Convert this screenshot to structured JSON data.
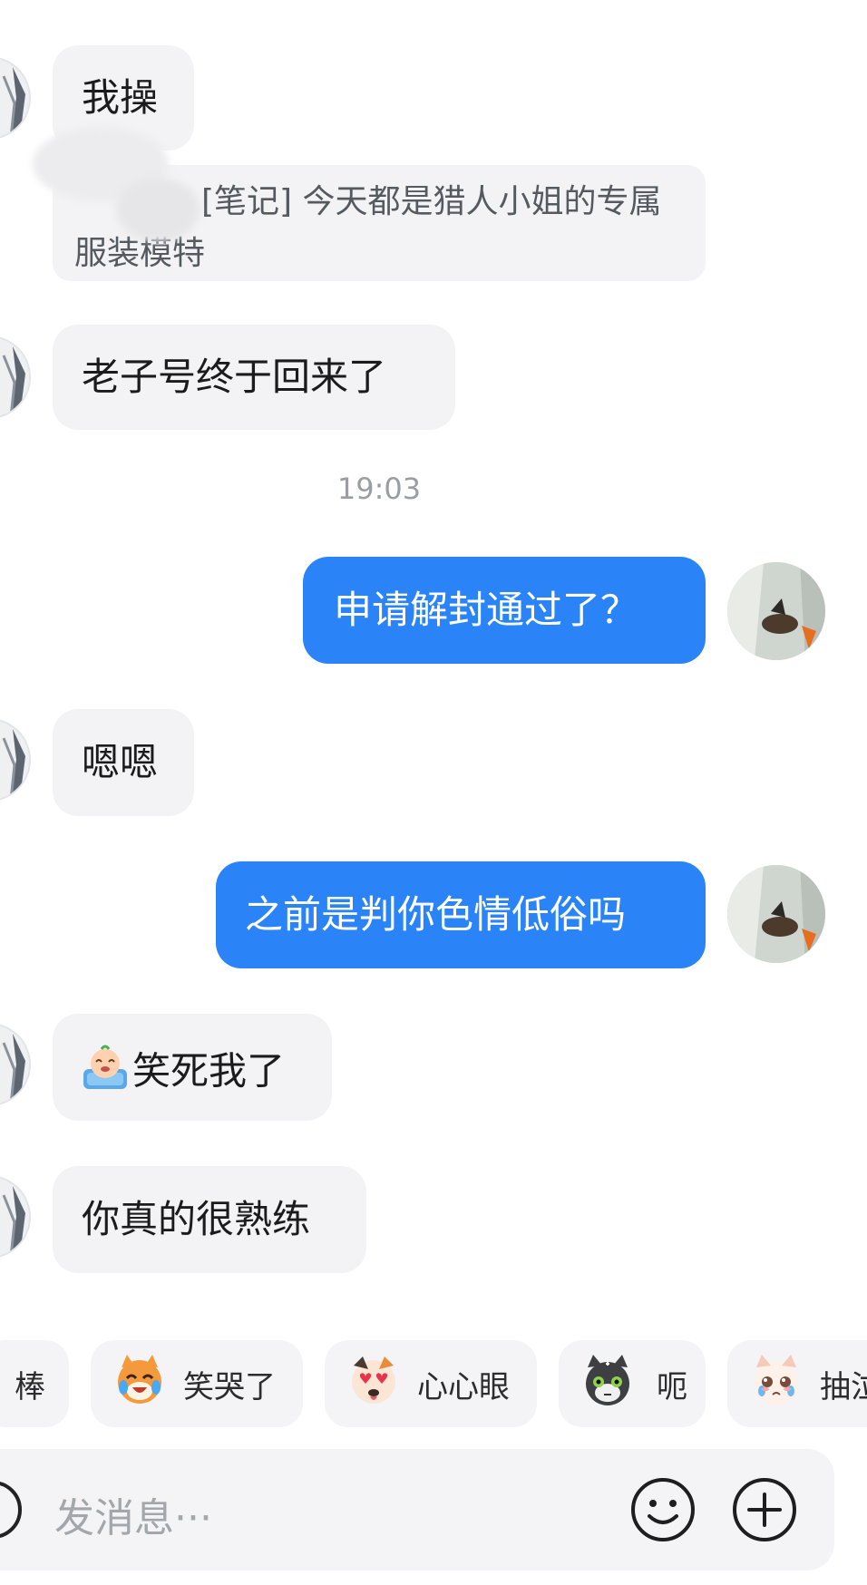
{
  "messages": [
    {
      "side": "left",
      "text": "我操"
    },
    {
      "side": "left",
      "type": "note_quote",
      "text": "[笔记] 今天都是猎人小姐的专属服装模特"
    },
    {
      "side": "left",
      "text": "老子号终于回来了"
    },
    {
      "side": "right",
      "text": "申请解封通过了？"
    },
    {
      "side": "left",
      "text": "嗯嗯"
    },
    {
      "side": "right",
      "text": "之前是判你色情低俗吗"
    },
    {
      "side": "left",
      "text": "笑死我了"
    },
    {
      "side": "left",
      "text": "你真的很熟练"
    }
  ],
  "timestamp": "19:03",
  "quick_reactions": [
    {
      "label": "棒"
    },
    {
      "label": "笑哭了",
      "icon": "crying-laughing-cat-icon"
    },
    {
      "label": "心心眼",
      "icon": "heart-eyes-dog-icon"
    },
    {
      "label": "呃",
      "icon": "awkward-cat-icon"
    },
    {
      "label": "抽泣",
      "icon": "sobbing-cat-icon"
    }
  ],
  "input": {
    "placeholder": "发消息···"
  },
  "colors": {
    "outgoing_bubble": "#2a84f7",
    "incoming_bubble": "#f3f3f5",
    "background": "#ffffff"
  }
}
